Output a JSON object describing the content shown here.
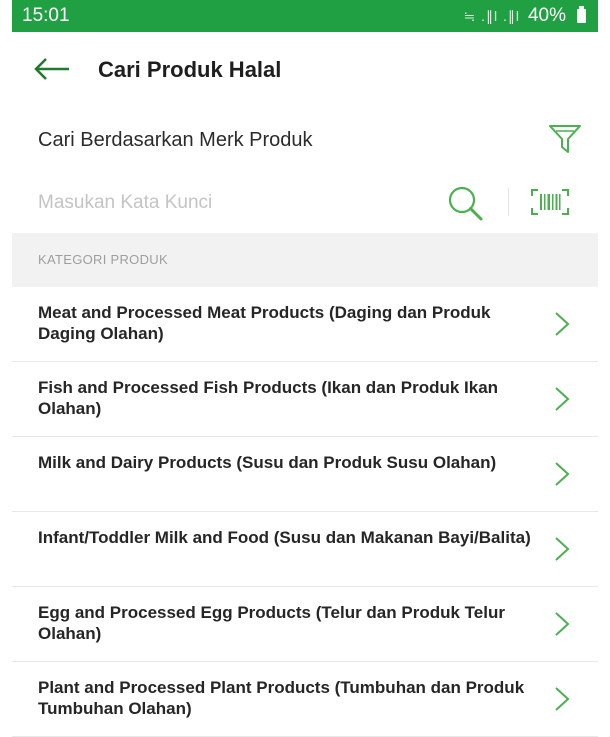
{
  "status_bar": {
    "time": "15:01",
    "signal": "≒ .∥l .∥l",
    "battery": "40%"
  },
  "header": {
    "title": "Cari Produk Halal"
  },
  "search_by": {
    "label": "Cari Berdasarkan Merk Produk"
  },
  "keyword": {
    "placeholder": "Masukan Kata Kunci",
    "value": ""
  },
  "section": {
    "title": "KATEGORI PRODUK"
  },
  "categories": [
    {
      "label": "Meat and Processed Meat Products (Daging dan Produk Daging Olahan)"
    },
    {
      "label": "Fish and Processed Fish Products (Ikan dan Produk Ikan Olahan)"
    },
    {
      "label": "Milk and Dairy Products (Susu dan Produk Susu Olahan)"
    },
    {
      "label": "Infant/Toddler Milk and Food (Susu dan Makanan Bayi/Balita)"
    },
    {
      "label": "Egg and Processed Egg Products (Telur dan Produk Telur Olahan)"
    },
    {
      "label": "Plant and Processed Plant Products (Tumbuhan dan Produk Tumbuhan Olahan)"
    }
  ],
  "icons": {
    "back": "arrow-left-icon",
    "filter": "filter-icon",
    "search": "search-icon",
    "barcode": "barcode-icon",
    "chevron": "chevron-right-icon"
  },
  "colors": {
    "status_bar": "#21a043",
    "accent_green": "#4caf50",
    "section_bg": "#f2f2f2"
  }
}
